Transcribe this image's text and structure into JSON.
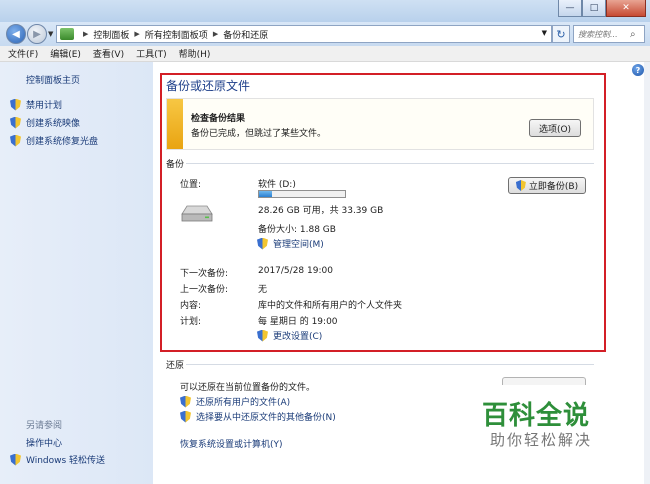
{
  "window": {
    "minimize_glyph": "—",
    "maximize_glyph": "□",
    "close_glyph": "✕"
  },
  "address": {
    "breadcrumbs": [
      "控制面板",
      "所有控制面板项",
      "备份和还原"
    ],
    "search_placeholder": "搜索控制..."
  },
  "menu": [
    "文件(F)",
    "编辑(E)",
    "查看(V)",
    "工具(T)",
    "帮助(H)"
  ],
  "sidebar": {
    "home": "控制面板主页",
    "items": [
      "禁用计划",
      "创建系统映像",
      "创建系统修复光盘"
    ],
    "see_also_title": "另请参阅",
    "see_also": [
      "操作中心",
      "Windows 轻松传送"
    ]
  },
  "main": {
    "title": "备份或还原文件",
    "notice": {
      "title": "检查备份结果",
      "text": "备份已完成，但跳过了某些文件。",
      "options_button": "选项(O)",
      "accent": "#f0b429"
    },
    "backup": {
      "section": "备份",
      "location_label": "位置:",
      "drive_name": "软件 (D:)",
      "drive_usage": 0.15,
      "space_text": "28.26 GB 可用，共 33.39 GB",
      "size_text": "备份大小: 1.88 GB",
      "manage_link": "管理空间(M)",
      "backup_now_button": "立即备份(B)",
      "next_label": "下一次备份:",
      "next_value": "2017/5/28 19:00",
      "last_label": "上一次备份:",
      "last_value": "无",
      "content_label": "内容:",
      "content_value": "库中的文件和所有用户的个人文件夹",
      "schedule_label": "计划:",
      "schedule_value": "每 星期日 的 19:00",
      "change_settings_link": "更改设置(C)"
    },
    "restore": {
      "section": "还原",
      "text": "可以还原在当前位置备份的文件。",
      "restore_all_link": "还原所有用户的文件(A)",
      "other_backup_link": "选择要从中还原文件的其他备份(N)",
      "recover_link": "恢复系统设置或计算机(Y)"
    }
  },
  "watermark": {
    "title": "百科全说",
    "subtitle": "助你轻松解决"
  },
  "colors": {
    "highlight_border": "#d31f26",
    "link": "#1a3b78",
    "title": "#1e3f8a",
    "watermark_green": "#2e8f3a"
  }
}
